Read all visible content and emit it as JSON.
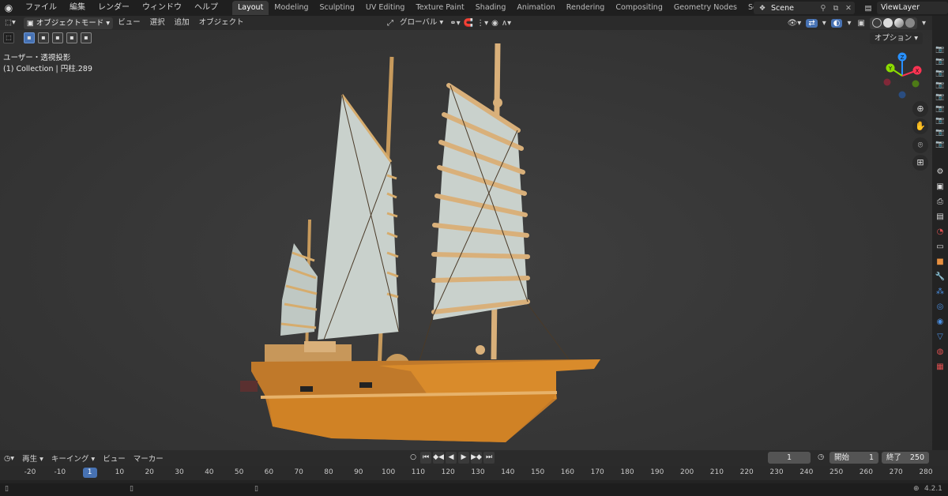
{
  "menu": [
    "ファイル",
    "編集",
    "レンダー",
    "ウィンドウ",
    "ヘルプ"
  ],
  "workspace_tabs": [
    {
      "label": "Layout",
      "active": true
    },
    {
      "label": "Modeling"
    },
    {
      "label": "Sculpting"
    },
    {
      "label": "UV Editing"
    },
    {
      "label": "Texture Paint"
    },
    {
      "label": "Shading"
    },
    {
      "label": "Animation"
    },
    {
      "label": "Rendering"
    },
    {
      "label": "Compositing"
    },
    {
      "label": "Geometry Nodes"
    },
    {
      "label": "Scripting"
    }
  ],
  "scene": {
    "name": "Scene"
  },
  "view_layer": {
    "name": "ViewLayer"
  },
  "viewport_header": {
    "mode": "オブジェクトモード",
    "menus": [
      "ビュー",
      "選択",
      "追加",
      "オブジェクト"
    ],
    "transform_orientation": "グローバル"
  },
  "options_label": "オプション",
  "viewport_info": {
    "view_name": "ユーザー・透視投影",
    "collection": "(1) Collection | 円柱.289"
  },
  "gizmo": {
    "x_color": "#ff3352",
    "y_color": "#8bdc00",
    "z_color": "#2890ff",
    "labels": [
      "X",
      "Y",
      "Z"
    ]
  },
  "timeline": {
    "playback": "再生",
    "keying": "キーイング",
    "view": "ビュー",
    "marker": "マーカー",
    "current_frame": "1",
    "start_label": "開始",
    "start": "1",
    "end_label": "終了",
    "end": "250",
    "ticks": [
      "-20",
      "-10",
      "1",
      "10",
      "20",
      "30",
      "40",
      "50",
      "60",
      "70",
      "80",
      "90",
      "100",
      "110",
      "120",
      "130",
      "140",
      "150",
      "160",
      "170",
      "180",
      "190",
      "200",
      "210",
      "220",
      "230",
      "240",
      "250",
      "260",
      "270",
      "280"
    ]
  },
  "status": {
    "version": "4.2.1"
  },
  "colors": {
    "accent": "#4772b3",
    "wood": "#c79a5c",
    "hull": "#d98b2b",
    "sail": "#c9d1cc"
  }
}
